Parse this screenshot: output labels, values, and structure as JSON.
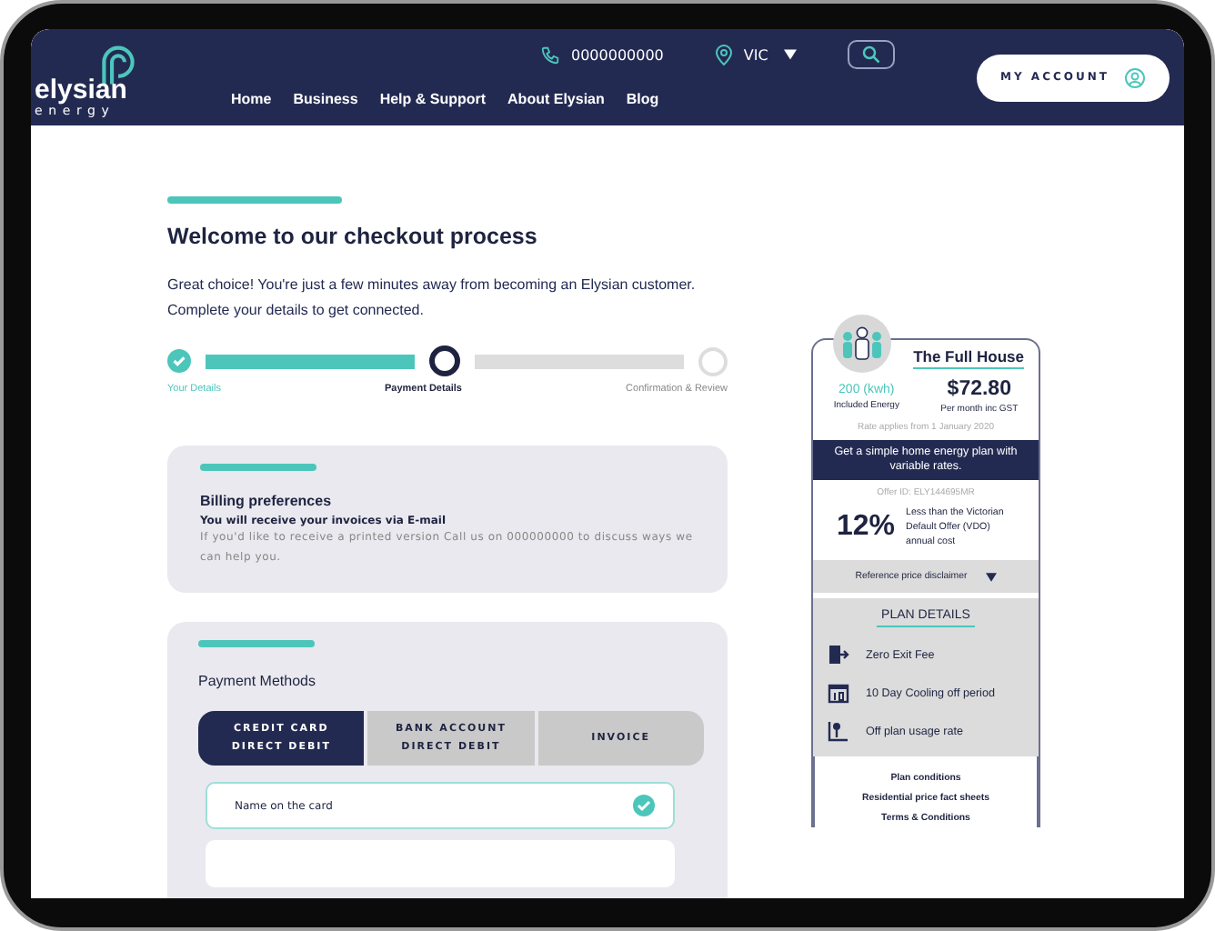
{
  "header": {
    "logo_word": "elysian",
    "logo_sub": "energy",
    "phone": "0000000000",
    "region": "VIC",
    "nav": [
      "Home",
      "Business",
      "Help & Support",
      "About Elysian",
      "Blog"
    ],
    "account_button": "MY ACCOUNT"
  },
  "checkout": {
    "title": "Welcome to our checkout process",
    "intro": "Great choice! You're just a few minutes away from becoming an Elysian customer. Complete your details to get connected.",
    "steps": [
      {
        "label": "Your Details",
        "completed": true,
        "selected": false
      },
      {
        "label": "Payment Details",
        "completed": false,
        "selected": true
      },
      {
        "label": "Confirmation & Review",
        "completed": false,
        "selected": false
      }
    ],
    "billing": {
      "heading": "Billing preferences",
      "subheading": "You will receive your invoices via E-mail",
      "note": "If you'd like to receive a printed version Call us on 000000000  to discuss ways we can help you."
    },
    "payment": {
      "heading": "Payment Methods",
      "methods": [
        {
          "lines": [
            "CREDIT CARD",
            "DIRECT DEBIT"
          ],
          "selected": true
        },
        {
          "lines": [
            "BANK ACCOUNT",
            "DIRECT DEBIT"
          ],
          "selected": false
        },
        {
          "lines": [
            "INVOICE"
          ],
          "selected": false
        }
      ],
      "fields": [
        {
          "label": "Name on the card",
          "valid": true
        }
      ]
    }
  },
  "plan": {
    "name": "The Full House",
    "energy_amount": "200 (kwh)",
    "energy_label": "Included Energy",
    "price": "$72.80",
    "price_label": "Per month inc GST",
    "rate_note": "Rate applies from 1 January 2020",
    "tagline": "Get a simple home energy plan with variable rates.",
    "offer_id": "Offer ID: ELY144695MR",
    "discount": "12%",
    "discount_note": "Less than the Victorian Default Offer (VDO) annual cost",
    "disclaimer": "Reference price disclaimer",
    "details_heading": "PLAN DETAILS",
    "features": [
      {
        "kind": "door",
        "label": "Zero Exit Fee"
      },
      {
        "kind": "calendar",
        "label": "10 Day Cooling off period"
      },
      {
        "kind": "meter",
        "label": "Off plan usage rate"
      }
    ],
    "links": [
      "Plan conditions",
      "Residential price fact sheets",
      "Terms & Conditions"
    ]
  }
}
